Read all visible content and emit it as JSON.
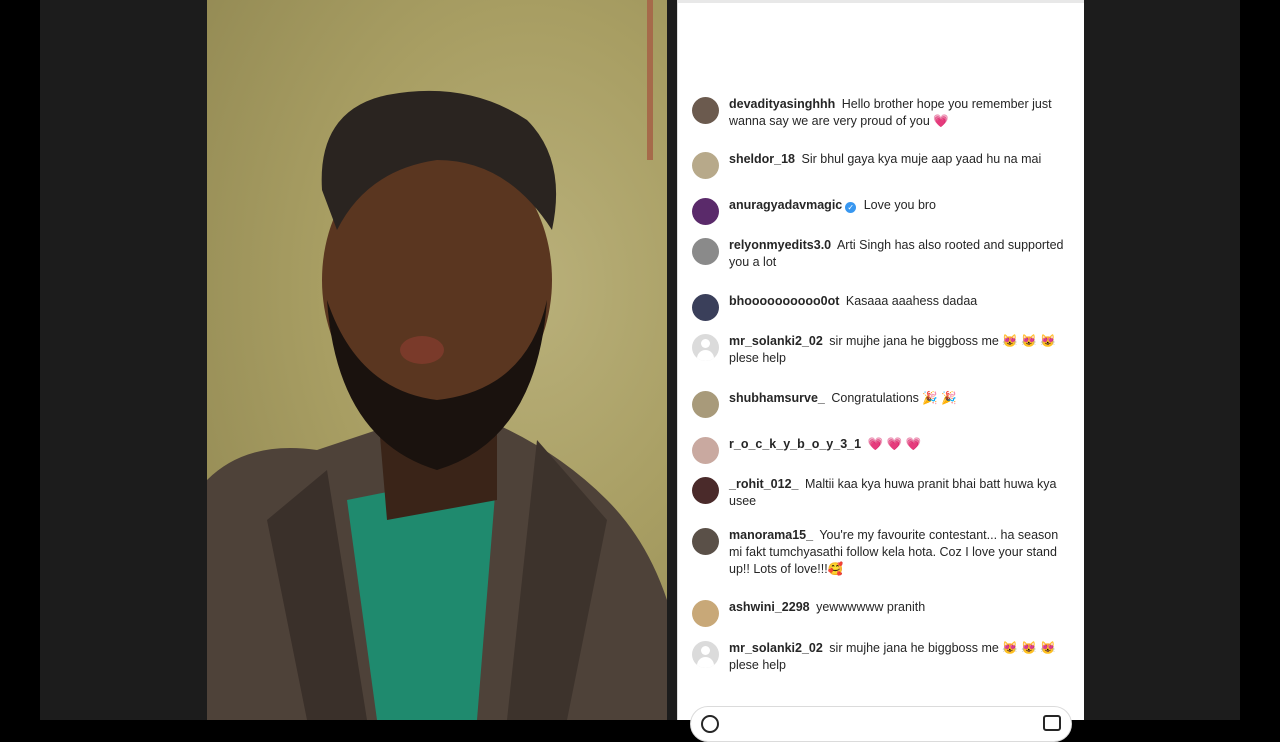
{
  "comments": [
    {
      "user": "devadityasinghhh",
      "text": "Hello brother hope you remember just wanna say we are very proud of you 💗",
      "avatar_color": "#6b5a4e"
    },
    {
      "user": "sheldor_18",
      "text": "Sir bhul gaya kya muje aap yaad hu na mai",
      "avatar_color": "#b7a98a"
    },
    {
      "user": "anuragyadavmagic",
      "verified": true,
      "text": "Love you bro",
      "avatar_color": "#5a2a6a"
    },
    {
      "user": "relyonmyedits3.0",
      "text": "Arti Singh has also rooted and supported you a lot",
      "avatar_color": "#8a8a8a"
    },
    {
      "user": "bhoooooooooo0ot",
      "text": "Kasaaa aaahess dadaa",
      "avatar_color": "#3a3f5a"
    },
    {
      "user": "mr_solanki2_02",
      "text": "sir mujhe jana he biggboss me 😻 😻 😻 plese help",
      "avatar_color": "default"
    },
    {
      "user": "shubhamsurve_",
      "text": "Congratulations 🎉 🎉",
      "avatar_color": "#a89a7a"
    },
    {
      "user": "r_o_c_k_y_b_o_y_3_1",
      "text": "💗 💗 💗",
      "avatar_color": "#c9a9a0"
    },
    {
      "user": "_rohit_012_",
      "text": "Maltii kaa kya huwa pranit bhai batt huwa kya usee",
      "avatar_color": "#4a2a2a"
    },
    {
      "user": "manorama15_",
      "text": "You're my favourite contestant... ha season mi fakt tumchyasathi follow kela hota. Coz I love your stand up!! Lots of love!!!🥰",
      "avatar_color": "#5a5048"
    },
    {
      "user": "ashwini_2298",
      "text": "yewwwwww pranith",
      "avatar_color": "#c8a878"
    },
    {
      "user": "mr_solanki2_02",
      "text": "sir mujhe jana he biggboss me 😻 😻 😻 plese help",
      "avatar_color": "default"
    }
  ]
}
